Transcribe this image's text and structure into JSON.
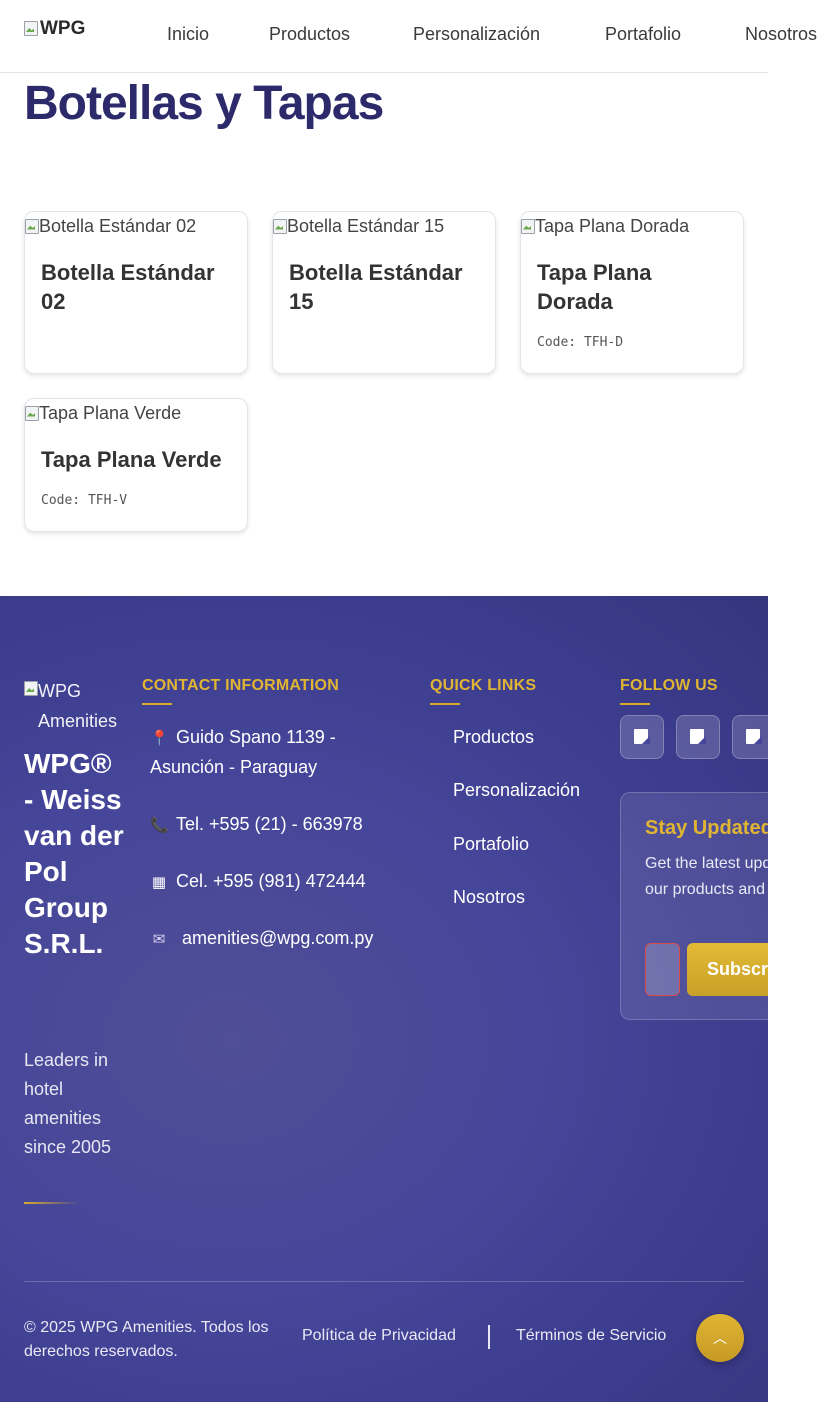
{
  "header": {
    "logo_alt": "WPG",
    "nav": [
      "Inicio",
      "Productos",
      "Personalización",
      "Portafolio",
      "Nosotros"
    ]
  },
  "page": {
    "title": "Botellas y Tapas"
  },
  "products": [
    {
      "img_alt": "Botella Estándar 02",
      "name": "Botella Estándar 02",
      "code": ""
    },
    {
      "img_alt": "Botella Estándar 15",
      "name": "Botella Estándar 15",
      "code": ""
    },
    {
      "img_alt": "Tapa Plana Dorada",
      "name": "Tapa Plana Dorada",
      "code": "Code: TFH-D"
    },
    {
      "img_alt": "Tapa Plana Verde",
      "name": "Tapa Plana Verde",
      "code": "Code: TFH-V"
    }
  ],
  "footer": {
    "logo_alt": "WPG Amenities",
    "company": "WPG® - Weiss van der Pol Group S.R.L.",
    "tagline": "Leaders in hotel amenities since 2005",
    "contact_heading": "CONTACT INFORMATION",
    "contact": [
      {
        "icon": "pin-icon",
        "text": "Guido Spano 1139 - Asunción - Paraguay"
      },
      {
        "icon": "phone-icon",
        "text": "Tel. +595 (21) - 663978"
      },
      {
        "icon": "mobile-icon",
        "text": "Cel. +595 (981) 472444"
      },
      {
        "icon": "mail-icon",
        "text": "amenities@wpg.com.py"
      }
    ],
    "quick_links_heading": "QUICK LINKS",
    "quick_links": [
      "Productos",
      "Personalización",
      "Portafolio",
      "Nosotros"
    ],
    "follow_heading": "FOLLOW US",
    "newsletter": {
      "title": "Stay Updated",
      "text": "Get the latest updates on our products and services",
      "button": "Subscribe"
    },
    "copyright": "© 2025 WPG Amenities. Todos los derechos reservados.",
    "privacy": "Política de Privacidad",
    "terms": "Términos de Servicio"
  },
  "colors": {
    "brand_navy": "#2d2a6b",
    "accent_gold": "#e0b532",
    "footer_bg": "#46469a"
  }
}
